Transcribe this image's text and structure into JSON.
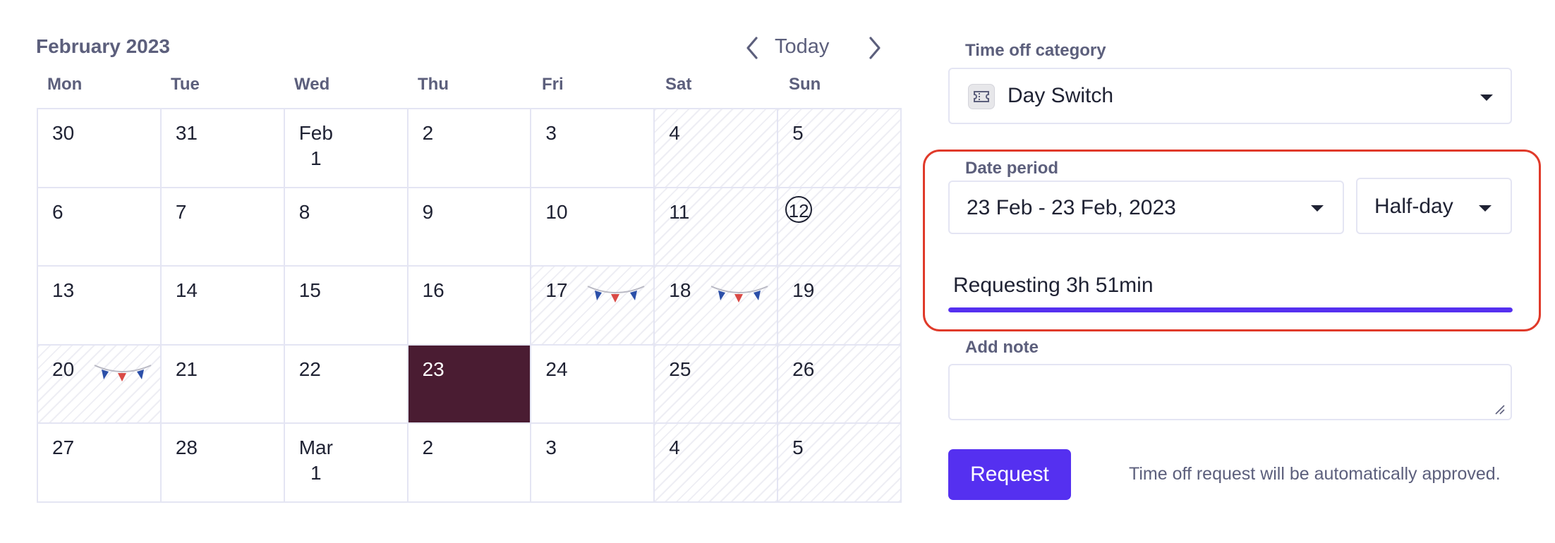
{
  "calendar": {
    "month_title": "February 2023",
    "today_label": "Today",
    "weekdays": [
      "Mon",
      "Tue",
      "Wed",
      "Thu",
      "Fri",
      "Sat",
      "Sun"
    ],
    "days": [
      {
        "label": "30",
        "weekend": false
      },
      {
        "label": "31",
        "weekend": false
      },
      {
        "label": "Feb\n1",
        "weekend": false
      },
      {
        "label": "2",
        "weekend": false
      },
      {
        "label": "3",
        "weekend": false
      },
      {
        "label": "4",
        "weekend": true
      },
      {
        "label": "5",
        "weekend": true
      },
      {
        "label": "6",
        "weekend": false
      },
      {
        "label": "7",
        "weekend": false
      },
      {
        "label": "8",
        "weekend": false
      },
      {
        "label": "9",
        "weekend": false
      },
      {
        "label": "10",
        "weekend": false
      },
      {
        "label": "11",
        "weekend": true
      },
      {
        "label": "12",
        "weekend": true,
        "today": true
      },
      {
        "label": "13",
        "weekend": false
      },
      {
        "label": "14",
        "weekend": false
      },
      {
        "label": "15",
        "weekend": false
      },
      {
        "label": "16",
        "weekend": false
      },
      {
        "label": "17",
        "weekend": false,
        "holiday": true
      },
      {
        "label": "18",
        "weekend": true,
        "holiday": true
      },
      {
        "label": "19",
        "weekend": true
      },
      {
        "label": "20",
        "weekend": false,
        "holiday": true
      },
      {
        "label": "21",
        "weekend": false
      },
      {
        "label": "22",
        "weekend": false
      },
      {
        "label": "23",
        "weekend": false,
        "selected": true
      },
      {
        "label": "24",
        "weekend": false
      },
      {
        "label": "25",
        "weekend": true
      },
      {
        "label": "26",
        "weekend": true
      },
      {
        "label": "27",
        "weekend": false
      },
      {
        "label": "28",
        "weekend": false
      },
      {
        "label": "Mar\n1",
        "weekend": false
      },
      {
        "label": "2",
        "weekend": false
      },
      {
        "label": "3",
        "weekend": false
      },
      {
        "label": "4",
        "weekend": true
      },
      {
        "label": "5",
        "weekend": true
      }
    ],
    "icons": {
      "prev": "chevron-left-icon",
      "next": "chevron-right-icon",
      "holiday": "bunting-flags-icon"
    },
    "colors": {
      "selected_day": "#4a1c32",
      "grid_line": "#e4e5f3",
      "bunting_blue": "#2b4fa8",
      "bunting_red": "#d94a46"
    }
  },
  "form": {
    "category_label": "Time off category",
    "category_value": "Day Switch",
    "category_icon": "ticket-icon",
    "date_label": "Date period",
    "date_value": "23 Feb - 23 Feb, 2023",
    "duration_value": "Half-day",
    "requesting_text": "Requesting 3h 51min",
    "requesting_progress": 1.0,
    "note_label": "Add note",
    "note_value": "",
    "request_button": "Request",
    "approval_note": "Time off request will be automatically approved.",
    "colors": {
      "accent": "#5530f0",
      "highlight": "#e03a2a",
      "label": "#5c5f7c"
    }
  }
}
